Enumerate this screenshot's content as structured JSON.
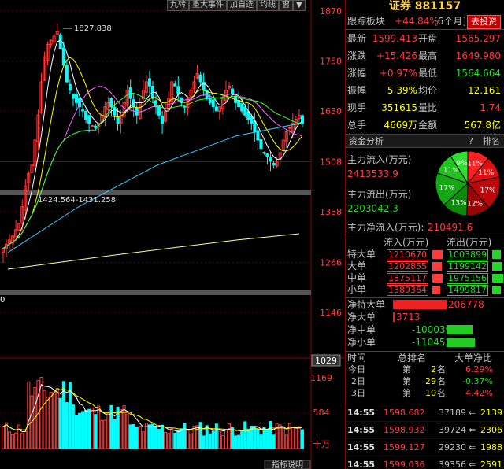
{
  "toolbar": [
    "九转",
    "重大事件",
    "加自选",
    "均线",
    "窗",
    "▼"
  ],
  "axis": {
    "price_labels": [
      "1870",
      "1750",
      "1630",
      "1508",
      "1388",
      "1266",
      "1146"
    ],
    "current_price_box": "1029",
    "vol_labels": [
      "1169",
      "584",
      "十万"
    ],
    "left_edge_label": "0"
  },
  "annotations": {
    "high": "1827.838",
    "range": "1424.564-1431.258"
  },
  "bottom_tab": "指标说明",
  "panel": {
    "title": "证券 881157",
    "track_label": "跟踪板块",
    "track_pct": "+44.84%",
    "track_period": "[6个月]",
    "invest_btn": "去投资",
    "quote_rows": [
      {
        "l1": "最新",
        "v1": "1599.413",
        "c1": "red",
        "l2": "开盘",
        "v2": "1565.297",
        "c2": "red"
      },
      {
        "l1": "涨跌",
        "v1": "+15.426",
        "c1": "red",
        "l2": "最高",
        "v2": "1649.980",
        "c2": "red"
      },
      {
        "l1": "涨幅",
        "v1": "+0.97%",
        "c1": "red",
        "l2": "最低",
        "v2": "1564.664",
        "c2": "green"
      },
      {
        "l1": "振幅",
        "v1": "5.39%",
        "c1": "yellow",
        "l2": "均价",
        "v2": "12.161",
        "c2": "yellow"
      },
      {
        "l1": "现手",
        "v1": "351615",
        "c1": "yellow",
        "l2": "量比",
        "v2": "1.74",
        "c2": "red"
      },
      {
        "l1": "总手",
        "v1": "4669万",
        "c1": "yellow",
        "l2": "金额",
        "v2": "567.8亿",
        "c2": "yellow"
      }
    ],
    "fund_section": "资金分析",
    "help": "?",
    "rank": "排名",
    "inflow_label": "主力流入(万元)",
    "inflow_value": "2413533.9",
    "outflow_label": "主力流出(万元)",
    "outflow_value": "2203042.3",
    "net_label": "主力净流入(万元):",
    "net_value": "210491.6",
    "pie_labels": [
      "11%",
      "11%",
      "17%",
      "12%",
      "13%",
      "17%",
      "11%",
      "9%"
    ],
    "flow_header_in": "流入(万元)",
    "flow_header_out": "流出(万元)",
    "flow_rows": [
      {
        "name": "特大单",
        "in": "1210670",
        "out": "1003899",
        "in_frac": 0.9,
        "out_frac": 0.75
      },
      {
        "name": "大单",
        "in": "1202855",
        "out": "1199142",
        "in_frac": 0.89,
        "out_frac": 0.89
      },
      {
        "name": "中单",
        "in": "1875117",
        "out": "1975156",
        "in_frac": 0.95,
        "out_frac": 1.0
      },
      {
        "name": "小单",
        "in": "1389364",
        "out": "1499817",
        "in_frac": 0.7,
        "out_frac": 0.76
      }
    ],
    "net_rows": [
      {
        "name": "净特大单",
        "value": "206778",
        "color": "red",
        "frac": 1.0
      },
      {
        "name": "净大单",
        "value": "3713",
        "color": "red",
        "frac": 0.03
      },
      {
        "name": "净中单",
        "value": "-100039",
        "color": "green",
        "frac": 0.48
      },
      {
        "name": "净小单",
        "value": "-110452",
        "color": "green",
        "frac": 0.53
      }
    ],
    "rank_head": {
      "time": "时间",
      "rank": "总排名",
      "ratio": "大单净比"
    },
    "rank_rows": [
      {
        "period": "今日",
        "pre": "第",
        "num": "2",
        "suf": "名",
        "ratio": "6.29%",
        "rc": "red"
      },
      {
        "period": "2日",
        "pre": "第",
        "num": "29",
        "suf": "名",
        "ratio": "-0.37%",
        "rc": "green"
      },
      {
        "period": "3日",
        "pre": "第",
        "num": "10",
        "suf": "名",
        "ratio": "4.42%",
        "rc": "red"
      }
    ],
    "ticks": [
      {
        "time": "14:55",
        "price": "1598.682",
        "vol": "37189",
        "arrow": "⇐",
        "n": "2139"
      },
      {
        "time": "14:55",
        "price": "1598.932",
        "vol": "39724",
        "arrow": "⇐",
        "n": "2306"
      },
      {
        "time": "14:55",
        "price": "1599.127",
        "vol": "29230",
        "arrow": "⇐",
        "n": "1988"
      },
      {
        "time": "14:55",
        "price": "1599.036",
        "vol": "39356",
        "arrow": "⇐",
        "n": "2591"
      }
    ]
  },
  "colors": {
    "up": "#ff3b3b",
    "down": "#00ffff",
    "grid": "#8b0000",
    "ma5": "#ffffff",
    "ma10": "#ffff00",
    "ma20": "#ff66ff",
    "ma30": "#33ff33",
    "ma60": "#33ccff",
    "ma120": "#ffff99"
  }
}
